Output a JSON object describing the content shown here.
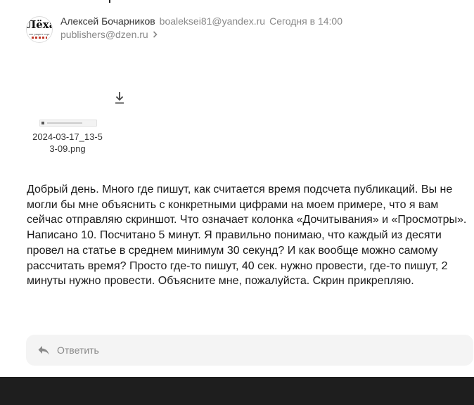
{
  "header": {
    "sender_name": "Алексей Бочарников",
    "sender_email": "boaleksei81@yandex.ru",
    "sent_time": "Сегодня в 14:00",
    "recipient": "publishers@dzen.ru"
  },
  "avatar": {
    "logo_text": "Лёха",
    "logo_sub": "нет рецепт сорт"
  },
  "attachment": {
    "file_name": "2024-03-17_13-53-09.png"
  },
  "message": {
    "body": "Добрый день. Много где пишут, как считается время подсчета публикаций. Вы не могли бы мне объяснить с конкретными цифрами на моем примере, что я вам сейчас отправляю скриншот. Что означает колонка «Дочитывания» и «Просмотры». Написано 10. Посчитано 5 минут. Я правильно понимаю, что каждый из десяти провел на статье в среднем минимум 30 секунд? И как вообще можно самому рассчитать время? Просто где-то пишут, 40 сек. нужно провести, где-то пишут, 2 минуты нужно провести. Объясните мне, пожалуйста. Скрин прикрепляю."
  },
  "reply": {
    "label": "Ответить"
  },
  "icons": {
    "download": "download-icon",
    "reply": "reply-arrow-icon",
    "chevron": "chevron-right-icon"
  }
}
